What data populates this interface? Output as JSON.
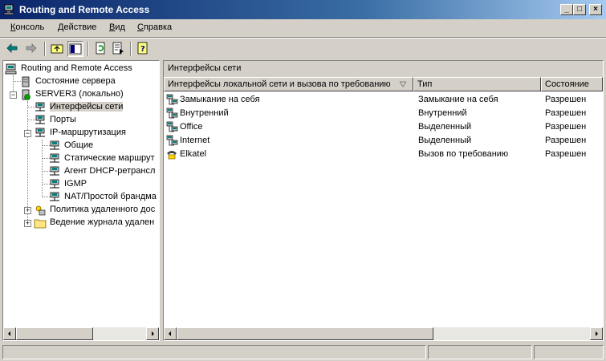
{
  "window": {
    "title": "Routing and Remote Access"
  },
  "menu": [
    {
      "label": "Консоль",
      "accel": "К"
    },
    {
      "label": "Действие",
      "accel": "Д"
    },
    {
      "label": "Вид",
      "accel": "В"
    },
    {
      "label": "Справка",
      "accel": "С"
    }
  ],
  "tree": {
    "root": "Routing and Remote Access",
    "server_status": "Состояние сервера",
    "server": "SERVER3 (локально)",
    "interfaces": "Интерфейсы сети",
    "ports": "Порты",
    "ip_routing": "IP-маршрутизация",
    "general": "Общие",
    "static_routes": "Статические маршрут",
    "dhcp_relay": "Агент DHCP-ретрансл",
    "igmp": "IGMP",
    "nat": "NAT/Простой брандма",
    "remote_policy": "Политика удаленного дос",
    "remote_logging": "Ведение журнала удален"
  },
  "details": {
    "pane_title": "Интерфейсы сети",
    "columns": [
      "Интерфейсы локальной сети и вызова по требованию",
      "Тип",
      "Состояние"
    ],
    "rows": [
      {
        "name": "Замыкание на себя",
        "type": "Замыкание на себя",
        "status": "Разрешен"
      },
      {
        "name": "Внутренний",
        "type": "Внутренний",
        "status": "Разрешен"
      },
      {
        "name": "Office",
        "type": "Выделенный",
        "status": "Разрешен"
      },
      {
        "name": "Internet",
        "type": "Выделенный",
        "status": "Разрешен"
      },
      {
        "name": "Elkatel",
        "type": "Вызов по требованию",
        "status": "Разрешен"
      }
    ]
  }
}
